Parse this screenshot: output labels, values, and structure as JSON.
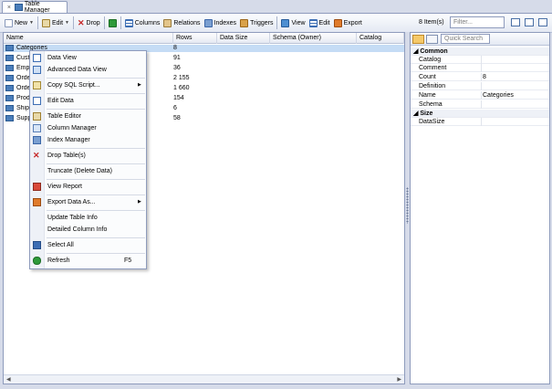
{
  "tab": {
    "close": "×",
    "title": "Table Manager"
  },
  "toolbar": {
    "new_label": "New",
    "edit_label": "Edit",
    "drop_label": "Drop",
    "columns_label": "Columns",
    "relations_label": "Relations",
    "indexes_label": "Indexes",
    "triggers_label": "Triggers",
    "view_label": "View",
    "edit2_label": "Edit",
    "export_label": "Export",
    "item_count": "8 Item(s)",
    "filter_placeholder": "Filter..."
  },
  "grid": {
    "columns": [
      "Name",
      "Rows",
      "Data Size",
      "Schema (Owner)",
      "Catalog"
    ],
    "rows": [
      {
        "name": "Categories",
        "rows": "8",
        "selected": true
      },
      {
        "name": "Customers",
        "rows": "91",
        "selected": false
      },
      {
        "name": "Employees",
        "rows": "36",
        "selected": false
      },
      {
        "name": "Order Details",
        "rows": "2 155",
        "selected": false
      },
      {
        "name": "Orders",
        "rows": "1 660",
        "selected": false
      },
      {
        "name": "Products",
        "rows": "154",
        "selected": false
      },
      {
        "name": "Shippers",
        "rows": "6",
        "selected": false
      },
      {
        "name": "Suppliers",
        "rows": "58",
        "selected": false
      }
    ]
  },
  "properties": {
    "quick_search_placeholder": "Quick Search",
    "categories": [
      {
        "name": "Common",
        "items": [
          {
            "key": "Catalog",
            "value": ""
          },
          {
            "key": "Comment",
            "value": ""
          },
          {
            "key": "Count",
            "value": "8"
          },
          {
            "key": "Definition",
            "value": ""
          },
          {
            "key": "Name",
            "value": "Categories"
          },
          {
            "key": "Schema",
            "value": ""
          }
        ]
      },
      {
        "name": "Size",
        "items": [
          {
            "key": "DataSize",
            "value": ""
          }
        ]
      }
    ]
  },
  "context_menu": {
    "items": [
      {
        "label": "Data View",
        "icon": "grid-icon",
        "shortcut": "",
        "submenu": false
      },
      {
        "label": "Advanced Data View",
        "icon": "grid-advanced-icon",
        "shortcut": "",
        "submenu": false
      },
      {
        "label": "Copy SQL Script...",
        "icon": "script-icon",
        "shortcut": "",
        "submenu": true
      },
      {
        "label": "Edit Data",
        "icon": "edit-data-icon",
        "shortcut": "",
        "submenu": false
      },
      {
        "label": "Table Editor",
        "icon": "pencil-icon",
        "shortcut": "",
        "submenu": false
      },
      {
        "label": "Column Manager",
        "icon": "columns-icon",
        "shortcut": "",
        "submenu": false
      },
      {
        "label": "Index Manager",
        "icon": "index-icon",
        "shortcut": "",
        "submenu": false
      },
      {
        "label": "Drop Table(s)",
        "icon": "drop-icon",
        "shortcut": "",
        "submenu": false
      },
      {
        "label": "Truncate (Delete Data)",
        "icon": "",
        "shortcut": "",
        "submenu": false
      },
      {
        "label": "View Report",
        "icon": "report-icon",
        "shortcut": "",
        "submenu": false
      },
      {
        "label": "Export Data As...",
        "icon": "export-icon",
        "shortcut": "",
        "submenu": true
      },
      {
        "label": "Update Table Info",
        "icon": "",
        "shortcut": "",
        "submenu": false
      },
      {
        "label": "Detailed Column Info",
        "icon": "",
        "shortcut": "",
        "submenu": false
      },
      {
        "label": "Select All",
        "icon": "select-all-icon",
        "shortcut": "",
        "submenu": false
      },
      {
        "label": "Refresh",
        "icon": "refresh-icon",
        "shortcut": "F5",
        "submenu": false
      }
    ],
    "arrow": "▶"
  }
}
